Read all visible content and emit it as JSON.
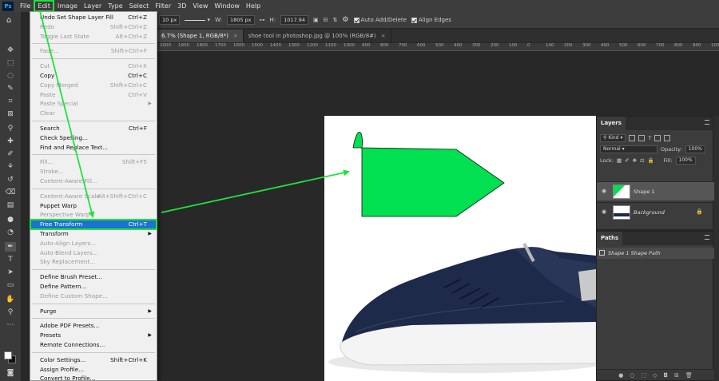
{
  "app": {
    "logo": "Ps"
  },
  "menubar": {
    "items": [
      "File",
      "Edit",
      "Image",
      "Layer",
      "Type",
      "Select",
      "Filter",
      "3D",
      "View",
      "Window",
      "Help"
    ]
  },
  "options": {
    "size": "10 px",
    "width_label": "W:",
    "width": "1805 px",
    "height_label": "H:",
    "height": "1017.94",
    "auto_add_delete": "Auto Add/Delete",
    "align_edges": "Align Edges"
  },
  "tabs": [
    {
      "label": "6.7% (Shape 1, RGB/8*)",
      "active": true
    },
    {
      "label": "shoe tool in photoshop.jpg @ 100% (RGB/8#)",
      "active": false
    }
  ],
  "ruler": [
    "2000",
    "1900",
    "1800",
    "1700",
    "1600",
    "1500",
    "1400",
    "1300",
    "1200",
    "1100",
    "1000",
    "900",
    "800",
    "700",
    "600",
    "500",
    "400",
    "300",
    "200",
    "100",
    "0",
    "100",
    "200",
    "300",
    "400",
    "500",
    "600",
    "700",
    "800",
    "900",
    "1000"
  ],
  "edit_menu": {
    "items": [
      {
        "label": "Undo Set Shape Layer Fill",
        "shortcut": "Ctrl+Z",
        "enabled": true
      },
      {
        "label": "Redo",
        "shortcut": "Shift+Ctrl+Z",
        "enabled": false
      },
      {
        "label": "Toggle Last State",
        "shortcut": "Alt+Ctrl+Z",
        "enabled": false
      },
      {
        "sep": true
      },
      {
        "label": "Fade...",
        "shortcut": "Shift+Ctrl+F",
        "enabled": false
      },
      {
        "sep": true
      },
      {
        "label": "Cut",
        "shortcut": "Ctrl+X",
        "enabled": false
      },
      {
        "label": "Copy",
        "shortcut": "Ctrl+C",
        "enabled": true
      },
      {
        "label": "Copy Merged",
        "shortcut": "Shift+Ctrl+C",
        "enabled": false
      },
      {
        "label": "Paste",
        "shortcut": "Ctrl+V",
        "enabled": false
      },
      {
        "label": "Paste Special",
        "submenu": true,
        "enabled": false
      },
      {
        "label": "Clear",
        "enabled": false
      },
      {
        "sep": true
      },
      {
        "label": "Search",
        "shortcut": "Ctrl+F",
        "enabled": true
      },
      {
        "label": "Check Spelling...",
        "enabled": true
      },
      {
        "label": "Find and Replace Text...",
        "enabled": true
      },
      {
        "sep": true
      },
      {
        "label": "Fill...",
        "shortcut": "Shift+F5",
        "enabled": false
      },
      {
        "label": "Stroke...",
        "enabled": false
      },
      {
        "label": "Content-Aware Fill...",
        "enabled": false
      },
      {
        "sep": true
      },
      {
        "label": "Content-Aware Scale",
        "shortcut": "Alt+Shift+Ctrl+C",
        "enabled": false
      },
      {
        "label": "Puppet Warp",
        "enabled": true
      },
      {
        "label": "Perspective Warp",
        "enabled": false
      },
      {
        "label": "Free Transform",
        "shortcut": "Ctrl+T",
        "enabled": true,
        "highlight": true
      },
      {
        "label": "Transform",
        "submenu": true,
        "enabled": true
      },
      {
        "label": "Auto-Align Layers...",
        "enabled": false
      },
      {
        "label": "Auto-Blend Layers...",
        "enabled": false
      },
      {
        "label": "Sky Replacement...",
        "enabled": false
      },
      {
        "sep": true
      },
      {
        "label": "Define Brush Preset...",
        "enabled": true
      },
      {
        "label": "Define Pattern...",
        "enabled": true
      },
      {
        "label": "Define Custom Shape...",
        "enabled": false
      },
      {
        "sep": true
      },
      {
        "label": "Purge",
        "submenu": true,
        "enabled": true
      },
      {
        "sep": true
      },
      {
        "label": "Adobe PDF Presets...",
        "enabled": true
      },
      {
        "label": "Presets",
        "submenu": true,
        "enabled": true
      },
      {
        "label": "Remote Connections...",
        "enabled": true
      },
      {
        "sep": true
      },
      {
        "label": "Color Settings...",
        "shortcut": "Shift+Ctrl+K",
        "enabled": true
      },
      {
        "label": "Assign Profile...",
        "enabled": true
      },
      {
        "label": "Convert to Profile...",
        "enabled": true
      }
    ]
  },
  "layers_panel": {
    "title": "Layers",
    "kind": "Kind",
    "blend_mode": "Normal",
    "opacity_label": "Opacity:",
    "opacity": "100%",
    "lock_label": "Lock:",
    "fill_label": "Fill:",
    "fill": "100%",
    "layers": [
      {
        "name": "Shape 1",
        "selected": true
      },
      {
        "name": "Background",
        "selected": false
      }
    ]
  },
  "paths_panel": {
    "title": "Paths",
    "paths": [
      "Shape 1 Shape Path"
    ]
  },
  "colors": {
    "shape_fill": "#00e050",
    "annotation": "#1fe33b",
    "menu_highlight": "#1a73d1"
  }
}
